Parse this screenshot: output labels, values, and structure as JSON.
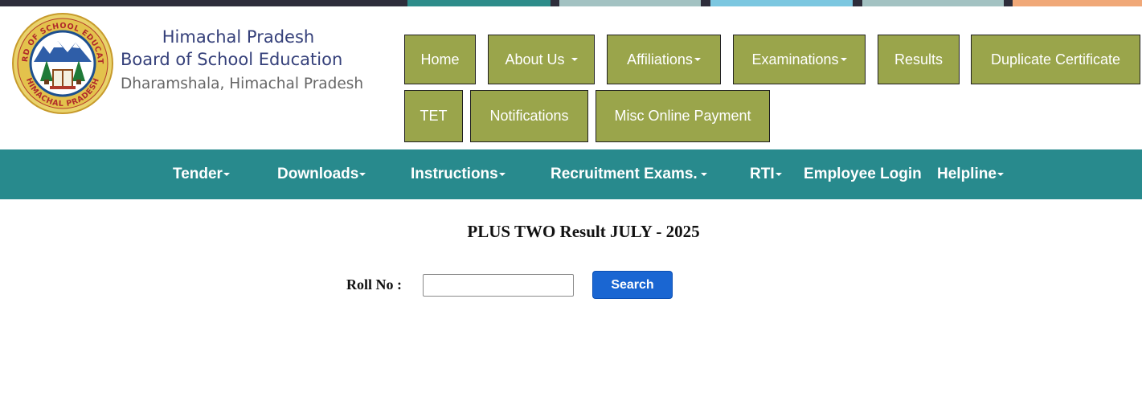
{
  "colors": {
    "strip": [
      "#2e2d3b",
      "#2e8c8a",
      "#a3c2c2",
      "#7cc7e0",
      "#a3c2c2",
      "#f0a878"
    ],
    "nav_button_bg": "#9aa54b",
    "main_nav_bg": "#288a8d",
    "search_button_bg": "#1a66d2"
  },
  "logo": {
    "ring_top_text": "BOARD OF SCHOOL EDUCATION",
    "ring_bottom_text": "HIMACHAL PRADESH",
    "icon": "board-emblem-logo"
  },
  "brand": {
    "line1": "Himachal Pradesh",
    "line2": "Board of School Education",
    "line3": "Dharamshala, Himachal Pradesh"
  },
  "top_nav": {
    "home": "Home",
    "about_us": "About Us",
    "affiliations": "Affiliations",
    "examinations": "Examinations",
    "results": "Results",
    "duplicate_certificate": "Duplicate Certificate",
    "tet": "TET",
    "notifications": "Notifications",
    "misc_online_payment": "Misc Online Payment"
  },
  "main_nav": {
    "tender": "Tender",
    "downloads": "Downloads",
    "instructions": "Instructions",
    "recruitment_exams": "Recruitment Exams.",
    "rti": "RTI",
    "employee_login": "Employee Login",
    "helpline": "Helpline"
  },
  "result_form": {
    "title": "PLUS TWO Result JULY - 2025",
    "roll_label": "Roll No :",
    "roll_value": "",
    "search_label": "Search"
  }
}
